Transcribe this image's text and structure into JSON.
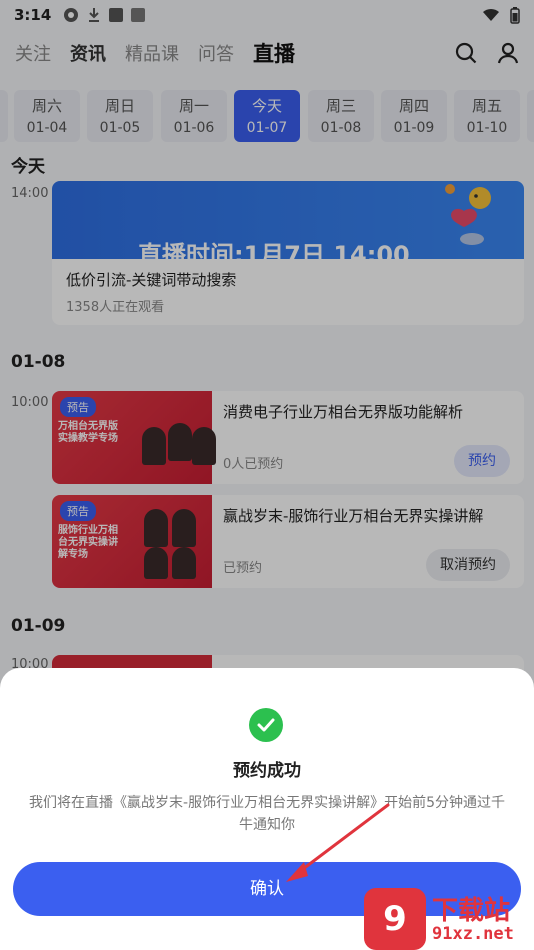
{
  "status_bar": {
    "time": "3:14"
  },
  "top_nav": {
    "tabs": [
      {
        "label": "关注",
        "state": "normal"
      },
      {
        "label": "资讯",
        "state": "bold"
      },
      {
        "label": "精品课",
        "state": "normal"
      },
      {
        "label": "问答",
        "state": "normal"
      },
      {
        "label": "直播",
        "state": "active"
      }
    ]
  },
  "dates": [
    {
      "weekday": "周六",
      "date": "01-04"
    },
    {
      "weekday": "周日",
      "date": "01-05"
    },
    {
      "weekday": "周一",
      "date": "01-06"
    },
    {
      "weekday": "今天",
      "date": "01-07",
      "active": true
    },
    {
      "weekday": "周三",
      "date": "01-08"
    },
    {
      "weekday": "周四",
      "date": "01-09"
    },
    {
      "weekday": "周五",
      "date": "01-10"
    }
  ],
  "today_section": {
    "title": "今天",
    "time": "14:00",
    "banner_text": "直播时间:1月7日 14:00",
    "course_title": "低价引流-关键词带动搜索",
    "viewers": "1358人正在观看"
  },
  "section_0108": {
    "title": "01-08",
    "time": "10:00",
    "cards": [
      {
        "tag": "预告",
        "thumb_text": "万相台无界版实操教学专场",
        "title": "消费电子行业万相台无界版功能解析",
        "meta": "0人已预约",
        "button": "预约"
      },
      {
        "tag": "预告",
        "thumb_text": "服饰行业万相台无界实操讲解专场",
        "title": "赢战岁末-服饰行业万相台无界实操讲解",
        "meta": "已预约",
        "button": "取消预约"
      }
    ]
  },
  "section_0109": {
    "title": "01-09",
    "time": "10:00"
  },
  "dialog": {
    "title": "预约成功",
    "message": "我们将在直播《赢战岁末-服饰行业万相台无界实操讲解》开始前5分钟通过千牛通知你",
    "confirm_label": "确认"
  },
  "watermark": {
    "text": "下载站",
    "url": "91xz.net",
    "logo": "9"
  },
  "colors": {
    "accent": "#3b5ff0",
    "success": "#2cc04f",
    "annotation_arrow": "#e0343d"
  }
}
